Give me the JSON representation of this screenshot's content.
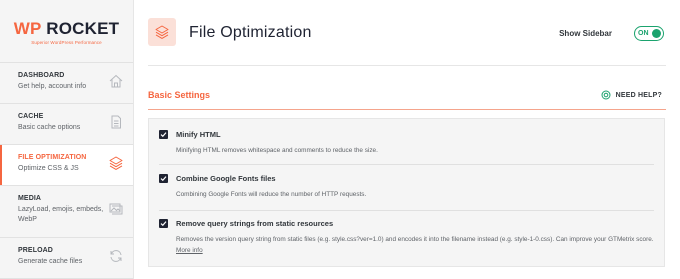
{
  "logo": {
    "brand_prefix": "WP",
    "brand_name": "ROCKET",
    "tagline": "Superior WordPress Performance"
  },
  "sidebar": {
    "items": [
      {
        "title": "DASHBOARD",
        "subtitle": "Get help, account info",
        "icon": "home-icon"
      },
      {
        "title": "CACHE",
        "subtitle": "Basic cache options",
        "icon": "document-icon"
      },
      {
        "title": "FILE OPTIMIZATION",
        "subtitle": "Optimize CSS & JS",
        "icon": "layers-icon",
        "active": true
      },
      {
        "title": "MEDIA",
        "subtitle": "LazyLoad, emojis, embeds, WebP",
        "icon": "image-icon"
      },
      {
        "title": "PRELOAD",
        "subtitle": "Generate cache files",
        "icon": "refresh-icon"
      }
    ]
  },
  "header": {
    "title": "File Optimization",
    "show_sidebar_label": "Show Sidebar",
    "toggle_label": "ON",
    "toggle_on": true
  },
  "section": {
    "title": "Basic Settings",
    "help_label": "NEED HELP?"
  },
  "options": [
    {
      "title": "Minify HTML",
      "description": "Minifying HTML removes whitespace and comments to reduce the size.",
      "checked": true
    },
    {
      "title": "Combine Google Fonts files",
      "description": "Combining Google Fonts will reduce the number of HTTP requests.",
      "checked": true
    },
    {
      "title": "Remove query strings from static resources",
      "description": "Removes the version query string from static files (e.g. style.css?ver=1.0) and encodes it into the filename instead (e.g. style-1-0.css). Can improve your GTMetrix score.",
      "link_label": "More info",
      "checked": true
    }
  ],
  "colors": {
    "accent": "#f56640",
    "toggle_green": "#1ba36e",
    "dark": "#1f2332"
  }
}
